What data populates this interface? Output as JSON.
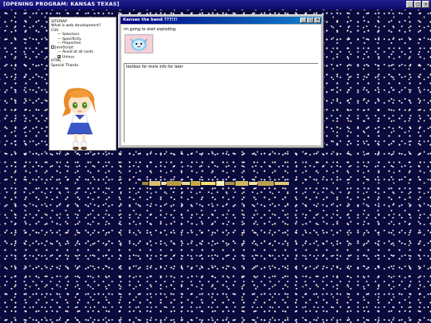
{
  "window_title": "[OPENING PROGRAM: KANSAS TEXAS]",
  "controls": {
    "minimize": "_",
    "maximize": "□",
    "close": "✕"
  },
  "sitemap": {
    "heading": "SITEMAP",
    "items": [
      {
        "label": "What is web development?"
      },
      {
        "label": "CSS"
      },
      {
        "label": "Selectors"
      },
      {
        "label": "Specificity"
      },
      {
        "label": "Properties"
      },
      {
        "label": "JavaScript"
      },
      {
        "label": "Avoid at all costs"
      },
      {
        "label": "Unless"
      },
      {
        "label": "HTML"
      },
      {
        "label": "Special Thanks"
      }
    ]
  },
  "inner_window": {
    "title": "Kansas the band ???!!!",
    "status": "im going to start exploding",
    "textbox": "textbox for more info for later"
  }
}
